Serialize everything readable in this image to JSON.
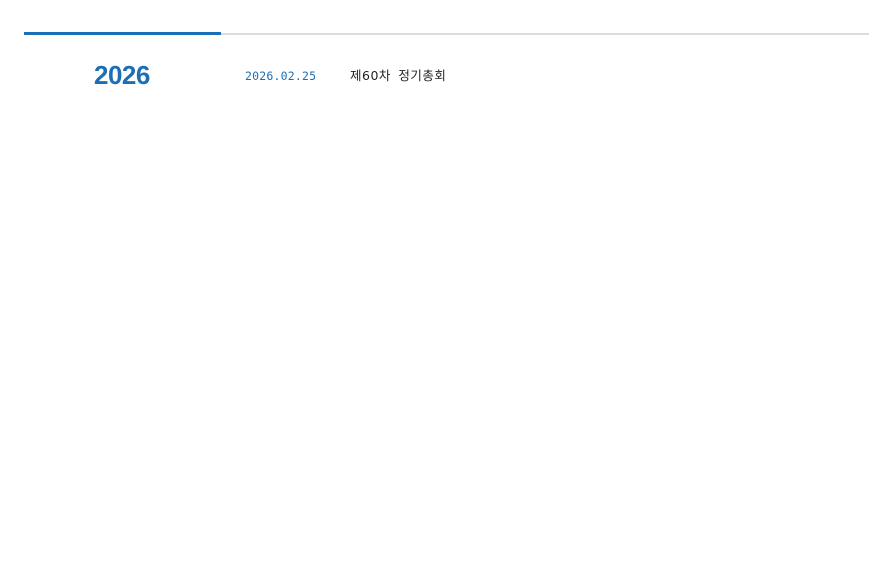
{
  "colors": {
    "accent": "#1a6fb5",
    "divider": "#dcdcdc",
    "text": "#222222"
  },
  "history": {
    "year": "2026",
    "events": [
      {
        "date": "2026.02.25",
        "title": "제60차 정기총회"
      }
    ]
  }
}
